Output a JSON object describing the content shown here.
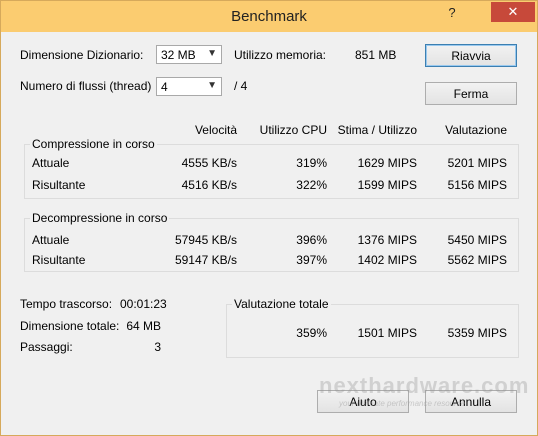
{
  "window": {
    "title": "Benchmark"
  },
  "titlebar": {
    "help_glyph": "?",
    "close_glyph": "✕"
  },
  "settings": {
    "dictionary_label": "Dimensione Dizionario:",
    "dictionary_value": "32 MB",
    "threads_label": "Numero di flussi (thread)",
    "threads_value": "4",
    "threads_max": "/ 4",
    "memory_label": "Utilizzo memoria:",
    "memory_value": "851 MB"
  },
  "buttons": {
    "restart": "Riavvia",
    "stop": "Ferma",
    "help": "Aiuto",
    "cancel": "Annulla"
  },
  "columns": [
    "Velocità",
    "Utilizzo CPU",
    "Stima / Utilizzo",
    "Valutazione"
  ],
  "compression": {
    "title": "Compressione in corso",
    "rows": [
      {
        "label": "Attuale",
        "speed": "4555 KB/s",
        "cpu": "319%",
        "estimate": "1629 MIPS",
        "rating": "5201 MIPS"
      },
      {
        "label": "Risultante",
        "speed": "4516 KB/s",
        "cpu": "322%",
        "estimate": "1599 MIPS",
        "rating": "5156 MIPS"
      }
    ]
  },
  "decompression": {
    "title": "Decompressione in corso",
    "rows": [
      {
        "label": "Attuale",
        "speed": "57945 KB/s",
        "cpu": "396%",
        "estimate": "1376 MIPS",
        "rating": "5450 MIPS"
      },
      {
        "label": "Risultante",
        "speed": "59147 KB/s",
        "cpu": "397%",
        "estimate": "1402 MIPS",
        "rating": "5562 MIPS"
      }
    ]
  },
  "stats": {
    "elapsed_label": "Tempo trascorso:",
    "elapsed_value": "00:01:23",
    "total_label": "Dimensione totale:",
    "total_value": "64 MB",
    "passes_label": "Passaggi:",
    "passes_value": "3"
  },
  "total_rating": {
    "title": "Valutazione totale",
    "cpu": "359%",
    "estimate": "1501 MIPS",
    "rating": "5359 MIPS"
  },
  "watermark": {
    "text": "nexthardware.com",
    "subtext": "your ultimate performance resource"
  },
  "colors": {
    "titlebar": "#fbcc70",
    "close": "#c7493a",
    "window_bg": "#f0f0f0"
  }
}
